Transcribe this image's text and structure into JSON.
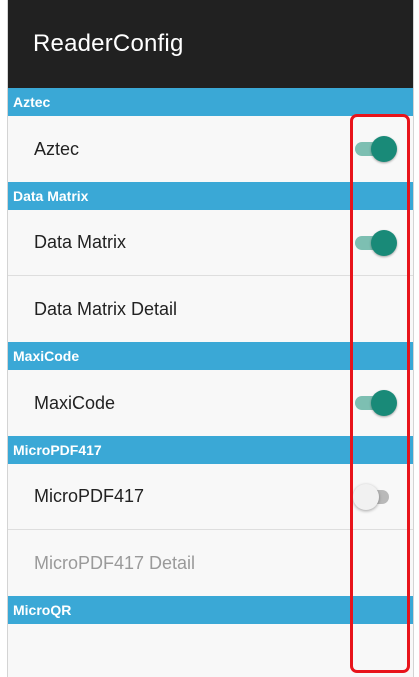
{
  "app": {
    "title": "ReaderConfig"
  },
  "sections": [
    {
      "header": "Aztec",
      "rows": [
        {
          "label": "Aztec",
          "switch": "on"
        }
      ]
    },
    {
      "header": "Data Matrix",
      "rows": [
        {
          "label": "Data Matrix",
          "switch": "on"
        },
        {
          "label": "Data Matrix Detail"
        }
      ]
    },
    {
      "header": "MaxiCode",
      "rows": [
        {
          "label": "MaxiCode",
          "switch": "on"
        }
      ]
    },
    {
      "header": "MicroPDF417",
      "rows": [
        {
          "label": "MicroPDF417",
          "switch": "off"
        },
        {
          "label": "MicroPDF417 Detail",
          "disabled": true
        }
      ]
    },
    {
      "header": "MicroQR"
    }
  ],
  "colors": {
    "app_bar": "#212121",
    "section_header": "#3aa8d6",
    "switch_on_thumb": "#198a78",
    "switch_on_track": "#7dbfb2",
    "highlight_outline": "#e8141b"
  }
}
